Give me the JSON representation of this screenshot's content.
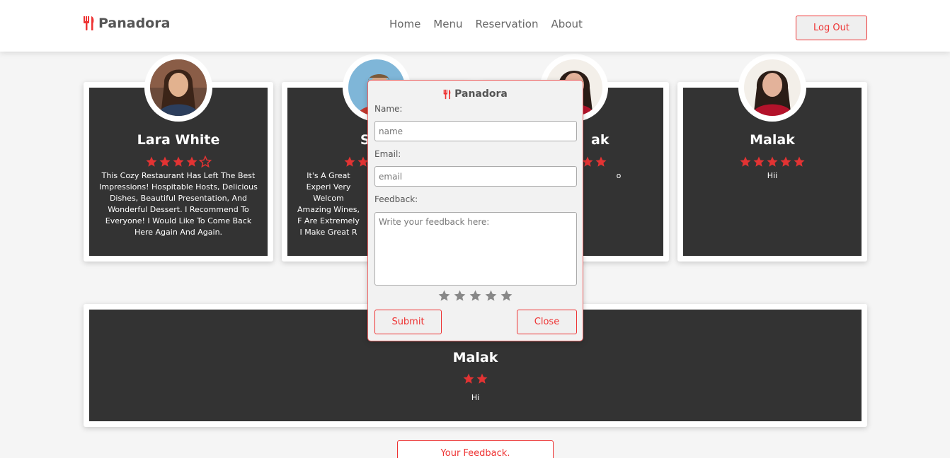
{
  "nav": {
    "brand": "Panadora",
    "links": [
      "Home",
      "Menu",
      "Reservation",
      "About"
    ],
    "logout_label": "Log Out"
  },
  "colors": {
    "accent": "#e33333",
    "card_bg": "#333333",
    "star_filled": "#e33333",
    "star_empty_modal": "#888888"
  },
  "reviews": [
    {
      "name": "Lara White",
      "rating": 4,
      "text": "This Cozy Restaurant Has Left The Best Impressions! Hospitable Hosts, Delicious Dishes, Beautiful Presentation, And Wonderful Dessert. I Recommend To Everyone! I Would Like To Come Back Here Again And Again."
    },
    {
      "name": "Sam",
      "rating": 5,
      "text": "It's A Great Experi Very Welcom Amazing Wines, F Are Extremely I Make Great R"
    },
    {
      "name": "ak",
      "rating": 5,
      "text": "o"
    },
    {
      "name": "Malak",
      "rating": 5,
      "text": "Hii"
    },
    {
      "name": "Malak",
      "rating": 2,
      "text": "Hi"
    }
  ],
  "feedback_button_label": "Your Feedback.",
  "modal": {
    "brand": "Panadora",
    "name_label": "Name:",
    "name_placeholder": "name",
    "email_label": "Email:",
    "email_placeholder": "email",
    "feedback_label": "Feedback:",
    "feedback_placeholder": "Write your feedback here:",
    "rating": 0,
    "submit_label": "Submit",
    "close_label": "Close"
  }
}
